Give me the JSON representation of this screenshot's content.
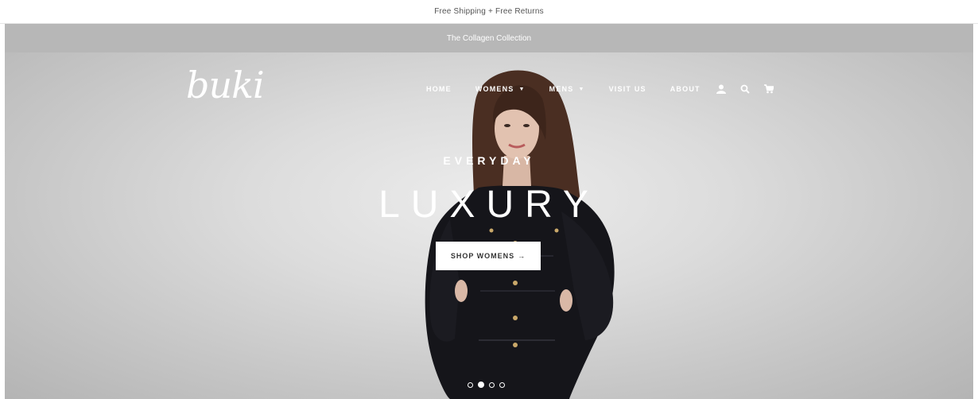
{
  "top_bar": {
    "text": "Free Shipping + Free Returns"
  },
  "announcement": {
    "text": "The Collagen Collection"
  },
  "header": {
    "logo": "buki",
    "nav": [
      {
        "label": "HOME",
        "has_dropdown": false
      },
      {
        "label": "WOMENS",
        "has_dropdown": true
      },
      {
        "label": "MENS",
        "has_dropdown": true
      },
      {
        "label": "VISIT US",
        "has_dropdown": false
      },
      {
        "label": "ABOUT",
        "has_dropdown": false
      }
    ],
    "icons": [
      "account-icon",
      "search-icon",
      "cart-icon"
    ]
  },
  "hero": {
    "subtitle": "EVERYDAY",
    "title": "LUXURY",
    "cta_label": "SHOP WOMENS",
    "cta_arrow": "→",
    "slides_total": 4,
    "active_slide": 2
  },
  "colors": {
    "announce_bg": "#b7b7b7",
    "hero_text": "#ffffff",
    "cta_bg": "#ffffff",
    "cta_text": "#333333"
  }
}
